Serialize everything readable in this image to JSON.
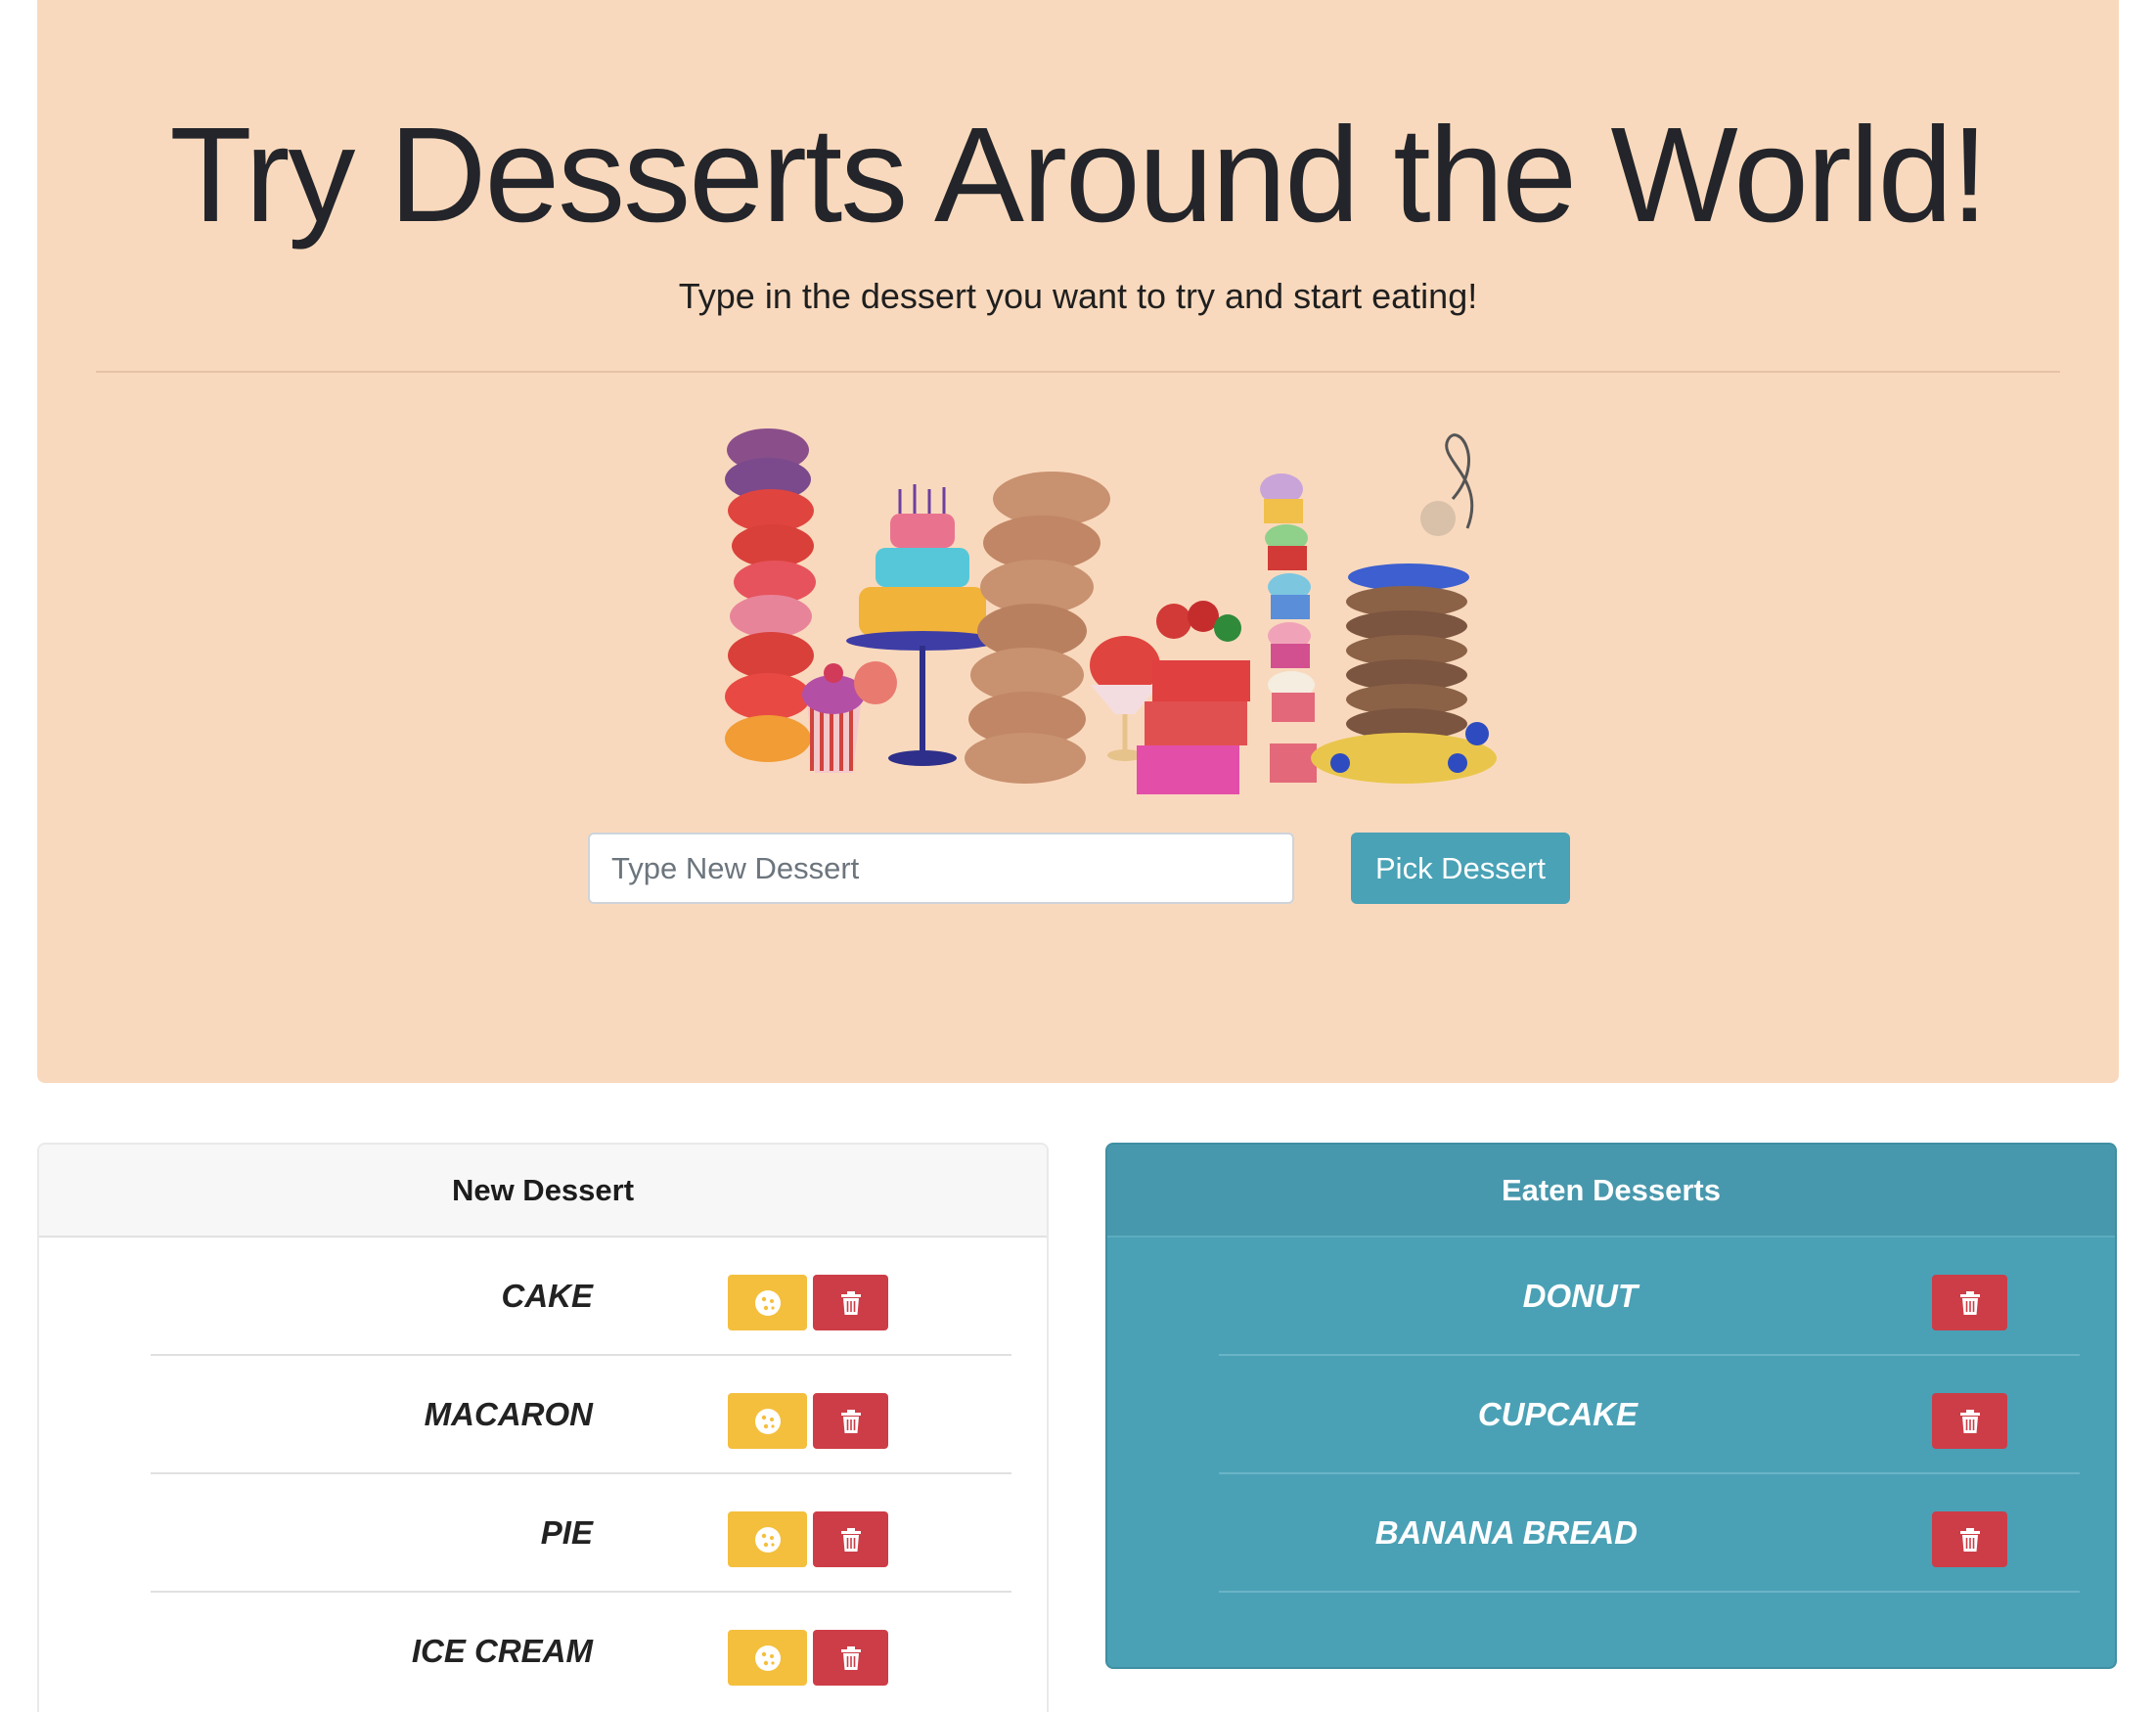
{
  "header": {
    "title": "Try Desserts Around the World!",
    "subtitle": "Type in the dessert you want to try and start eating!"
  },
  "form": {
    "placeholder": "Type New Dessert",
    "value": "",
    "submit_label": "Pick Dessert"
  },
  "new_desserts": {
    "heading": "New Dessert",
    "items": [
      "CAKE",
      "MACARON",
      "PIE",
      "ICE CREAM"
    ]
  },
  "eaten_desserts": {
    "heading": "Eaten Desserts",
    "items": [
      "DONUT",
      "CUPCAKE",
      "BANANA BREAD"
    ]
  },
  "icons": {
    "eat": "cookie-icon",
    "delete": "trash-icon"
  },
  "colors": {
    "hero_background": "#f9d9bd",
    "primary_button": "#4aa2b6",
    "eat_button": "#f4bf3d",
    "delete_button": "#cd3d47",
    "eaten_card": "#4aa1b6"
  }
}
